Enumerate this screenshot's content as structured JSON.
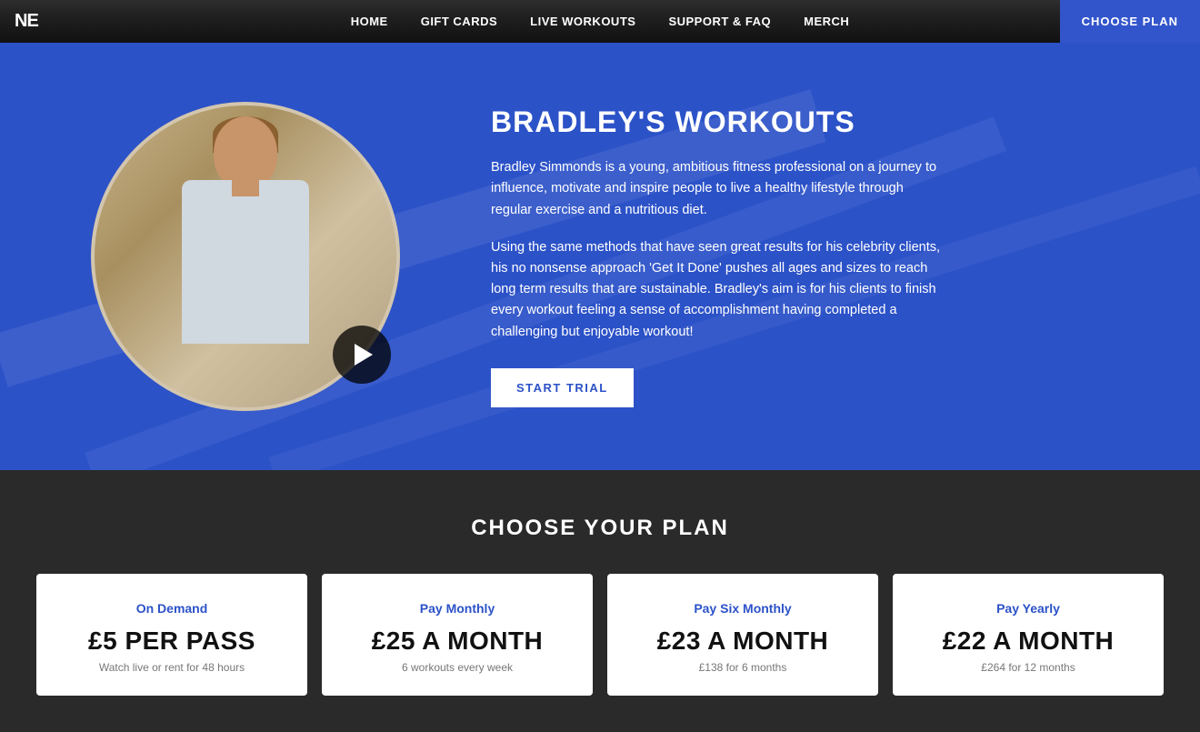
{
  "navbar": {
    "logo": "NE",
    "links": [
      {
        "label": "HOME",
        "id": "home"
      },
      {
        "label": "GIFT CARDS",
        "id": "gift-cards"
      },
      {
        "label": "LIVE WORKOUTS",
        "id": "live-workouts"
      },
      {
        "label": "SUPPORT & FAQ",
        "id": "support-faq"
      },
      {
        "label": "MERCH",
        "id": "merch"
      }
    ],
    "cta_label": "CHOOSE PLAN"
  },
  "hero": {
    "title": "BRADLEY'S WORKOUTS",
    "desc1": "Bradley Simmonds is a young, ambitious fitness professional on a journey to influence, motivate and inspire people to live a healthy lifestyle through regular exercise and a nutritious diet.",
    "desc2": "Using the same methods that have seen great results for his celebrity clients, his no nonsense approach 'Get It Done' pushes all ages and sizes to reach long term results that are sustainable. Bradley's aim is for his clients to finish every workout feeling a sense of accomplishment having completed a challenging but enjoyable workout!",
    "trial_btn": "START TRIAL"
  },
  "plans_section": {
    "title": "CHOOSE YOUR PLAN",
    "plans": [
      {
        "name_prefix": "On",
        "name_suffix": " Demand",
        "price": "£5 PER PASS",
        "sub": "Watch live or rent for 48 hours"
      },
      {
        "name_prefix": "Pay",
        "name_suffix": " Monthly",
        "price": "£25 A MONTH",
        "sub": "6 workouts every week"
      },
      {
        "name_prefix": "Pay",
        "name_suffix": " Six Monthly",
        "price": "£23 A MONTH",
        "sub": "£138 for 6 months"
      },
      {
        "name_prefix": "Pay",
        "name_suffix": " Yearly",
        "price": "£22 A MONTH",
        "sub": "£264 for 12 months"
      }
    ]
  }
}
